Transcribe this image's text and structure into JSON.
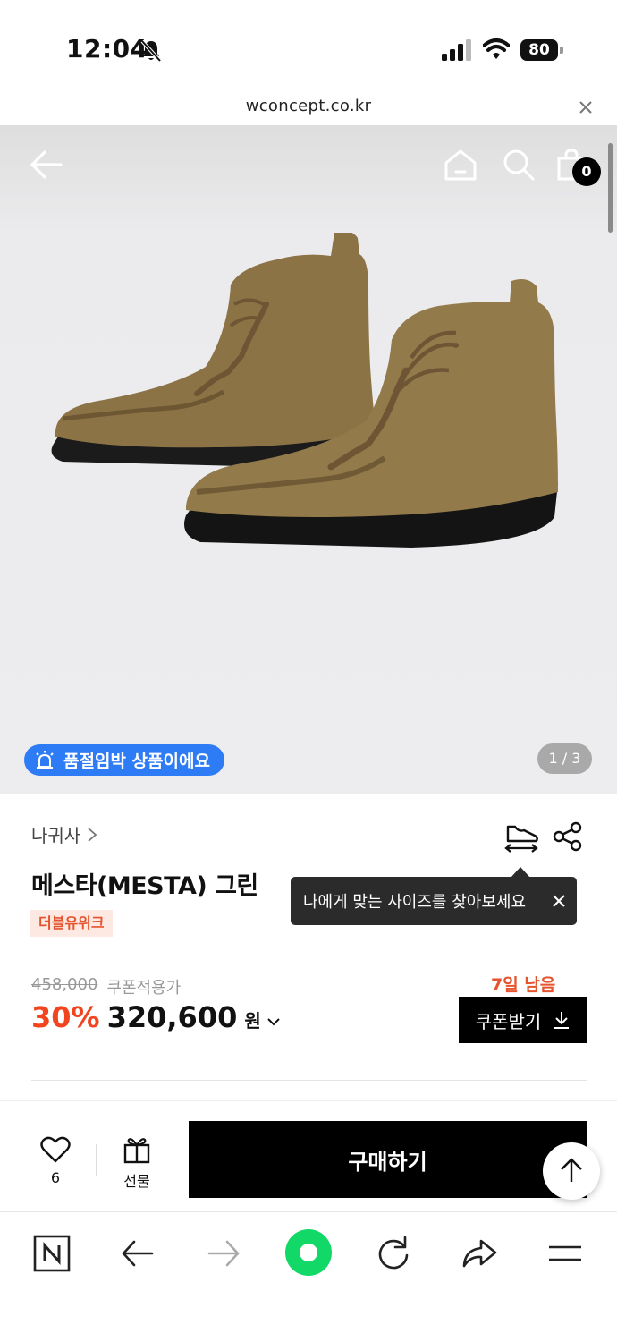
{
  "status": {
    "time": "12:04",
    "battery": "80"
  },
  "browser": {
    "url": "wconcept.co.kr"
  },
  "hero": {
    "cart_count": "0",
    "soldout_notice": "품절임박 상품이에요",
    "page_indicator": "1 / 3"
  },
  "product": {
    "brand": "나귀사",
    "name": "메스타(MESTA) 그린",
    "badge": "더블유위크",
    "size_tooltip": "나에게 맞는 사이즈를 찾아보세요",
    "original_price": "458,000",
    "coupon_label": "쿠폰적용가",
    "discount": "30%",
    "price": "320,600",
    "currency": "원",
    "days_left": "7일 남음",
    "coupon_button": "쿠폰받기"
  },
  "purchase_bar": {
    "like_count": "6",
    "gift_label": "선물",
    "buy_label": "구매하기"
  },
  "colors": {
    "accent_blue": "#2e7bf6",
    "discount_red": "#f0451f",
    "naver_green": "#12d868"
  },
  "icons": [
    "bell-slash-icon",
    "signal-icon",
    "wifi-icon",
    "back-arrow-icon",
    "home-icon",
    "search-icon",
    "shopping-bag-icon",
    "alarm-icon",
    "chevron-right-icon",
    "size-guide-icon",
    "share-icon",
    "close-icon",
    "chevron-down-icon",
    "download-icon",
    "heart-icon",
    "gift-icon",
    "arrow-up-icon",
    "naver-icon",
    "reload-icon",
    "share-arrow-icon",
    "menu-icon"
  ]
}
